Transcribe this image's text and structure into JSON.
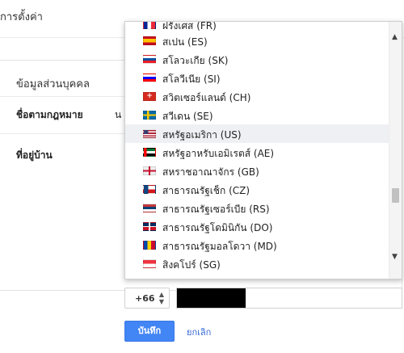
{
  "page": {
    "title": "การตั้งค่า"
  },
  "card": {
    "title": "ข้อมูลส่วนบุคคล",
    "legal_name_label": "ชื่อตามกฎหมาย",
    "legal_name_peek": "น",
    "address_label": "ที่อยู่บ้าน"
  },
  "phone": {
    "country_code": "+66"
  },
  "actions": {
    "save_label": "บันทึก",
    "cancel_label": "ยกเลิก"
  },
  "dropdown": {
    "items": [
      {
        "label": "ฝรั่งเศส (FR)",
        "flag": "flag-fr-icon"
      },
      {
        "label": "สเปน (ES)",
        "flag": "flag-es-icon"
      },
      {
        "label": "สโลวะเกีย (SK)",
        "flag": "flag-sk-icon"
      },
      {
        "label": "สโลวีเนีย (SI)",
        "flag": "flag-si-icon"
      },
      {
        "label": "สวิตเซอร์แลนด์ (CH)",
        "flag": "flag-ch-icon"
      },
      {
        "label": "สวีเดน (SE)",
        "flag": "flag-se-icon"
      },
      {
        "label": "สหรัฐอเมริกา (US)",
        "flag": "flag-us-icon",
        "selected": true
      },
      {
        "label": "สหรัฐอาหรับเอมิเรตส์ (AE)",
        "flag": "flag-ae-icon"
      },
      {
        "label": "สหราชอาณาจักร (GB)",
        "flag": "flag-gb-icon"
      },
      {
        "label": "สาธารณรัฐเช็ก (CZ)",
        "flag": "flag-cz-icon"
      },
      {
        "label": "สาธารณรัฐเซอร์เบีย (RS)",
        "flag": "flag-rs-icon"
      },
      {
        "label": "สาธารณรัฐโดมินิกัน (DO)",
        "flag": "flag-do-icon"
      },
      {
        "label": "สาธารณรัฐมอลโดวา (MD)",
        "flag": "flag-md-icon"
      },
      {
        "label": "สิงคโปร์ (SG)",
        "flag": "flag-sg-icon"
      }
    ],
    "scroll_position": 0.72
  }
}
